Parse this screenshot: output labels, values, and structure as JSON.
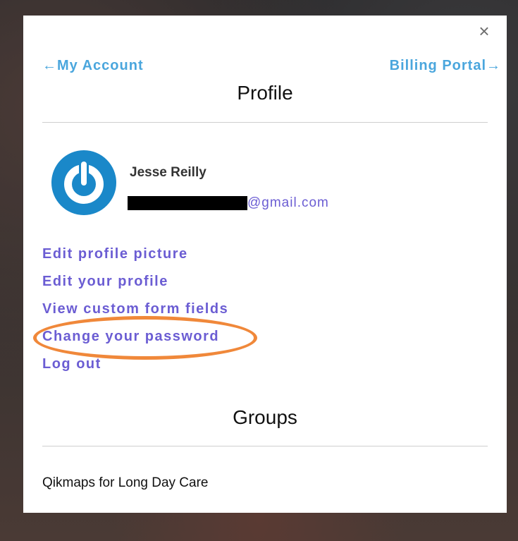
{
  "header": {
    "close_symbol": "×",
    "back_link": "My Account",
    "forward_link": "Billing Portal",
    "back_arrow": "←",
    "forward_arrow": "→"
  },
  "profile": {
    "title": "Profile",
    "user_name": "Jesse Reilly",
    "email_visible": "@gmail.com",
    "avatar_icon": "power-icon",
    "actions": [
      "Edit profile picture",
      "Edit your profile",
      "View custom form fields",
      "Change your password",
      "Log out"
    ]
  },
  "groups": {
    "title": "Groups",
    "items": [
      "Qikmaps for Long Day Care"
    ]
  },
  "colors": {
    "link_blue": "#4aa6dd",
    "action_purple": "#6b5dd3",
    "highlight_orange": "#f0883a",
    "avatar_blue": "#1a88c9"
  }
}
